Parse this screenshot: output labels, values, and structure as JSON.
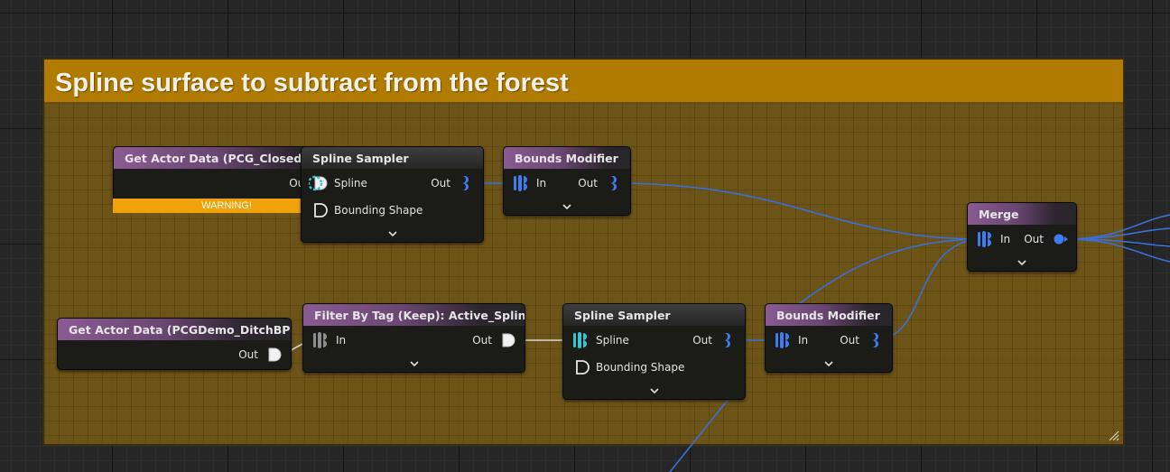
{
  "comment": {
    "title": "Spline surface to subtract from the forest"
  },
  "nodes": {
    "get_actor_closed": {
      "title": "Get Actor Data (PCG_ClosedSpline)",
      "out_label": "Out",
      "warning": "WARNING!"
    },
    "spline_sampler_1": {
      "title": "Spline Sampler",
      "in_label": "Spline",
      "in2_label": "Bounding Shape",
      "out_label": "Out"
    },
    "bounds_modifier_1": {
      "title": "Bounds Modifier",
      "in_label": "In",
      "out_label": "Out"
    },
    "merge": {
      "title": "Merge",
      "in_label": "In",
      "out_label": "Out"
    },
    "get_actor_ditch": {
      "title": "Get Actor Data (PCGDemo_DitchBP)",
      "out_label": "Out"
    },
    "filter_by_tag": {
      "title": "Filter By Tag (Keep): Active_Spline",
      "in_label": "In",
      "out_label": "Out"
    },
    "spline_sampler_2": {
      "title": "Spline Sampler",
      "in_label": "Spline",
      "in2_label": "Bounding Shape",
      "out_label": "Out"
    },
    "bounds_modifier_2": {
      "title": "Bounds Modifier",
      "in_label": "In",
      "out_label": "Out"
    }
  },
  "colors": {
    "wire_blue": "#3b6fd8",
    "wire_white": "#d8d8d8",
    "comment_header": "#b07b00",
    "warning": "#f0a20a",
    "pin_blue": "#3f7cf0",
    "pin_cyan": "#35c6d6"
  }
}
